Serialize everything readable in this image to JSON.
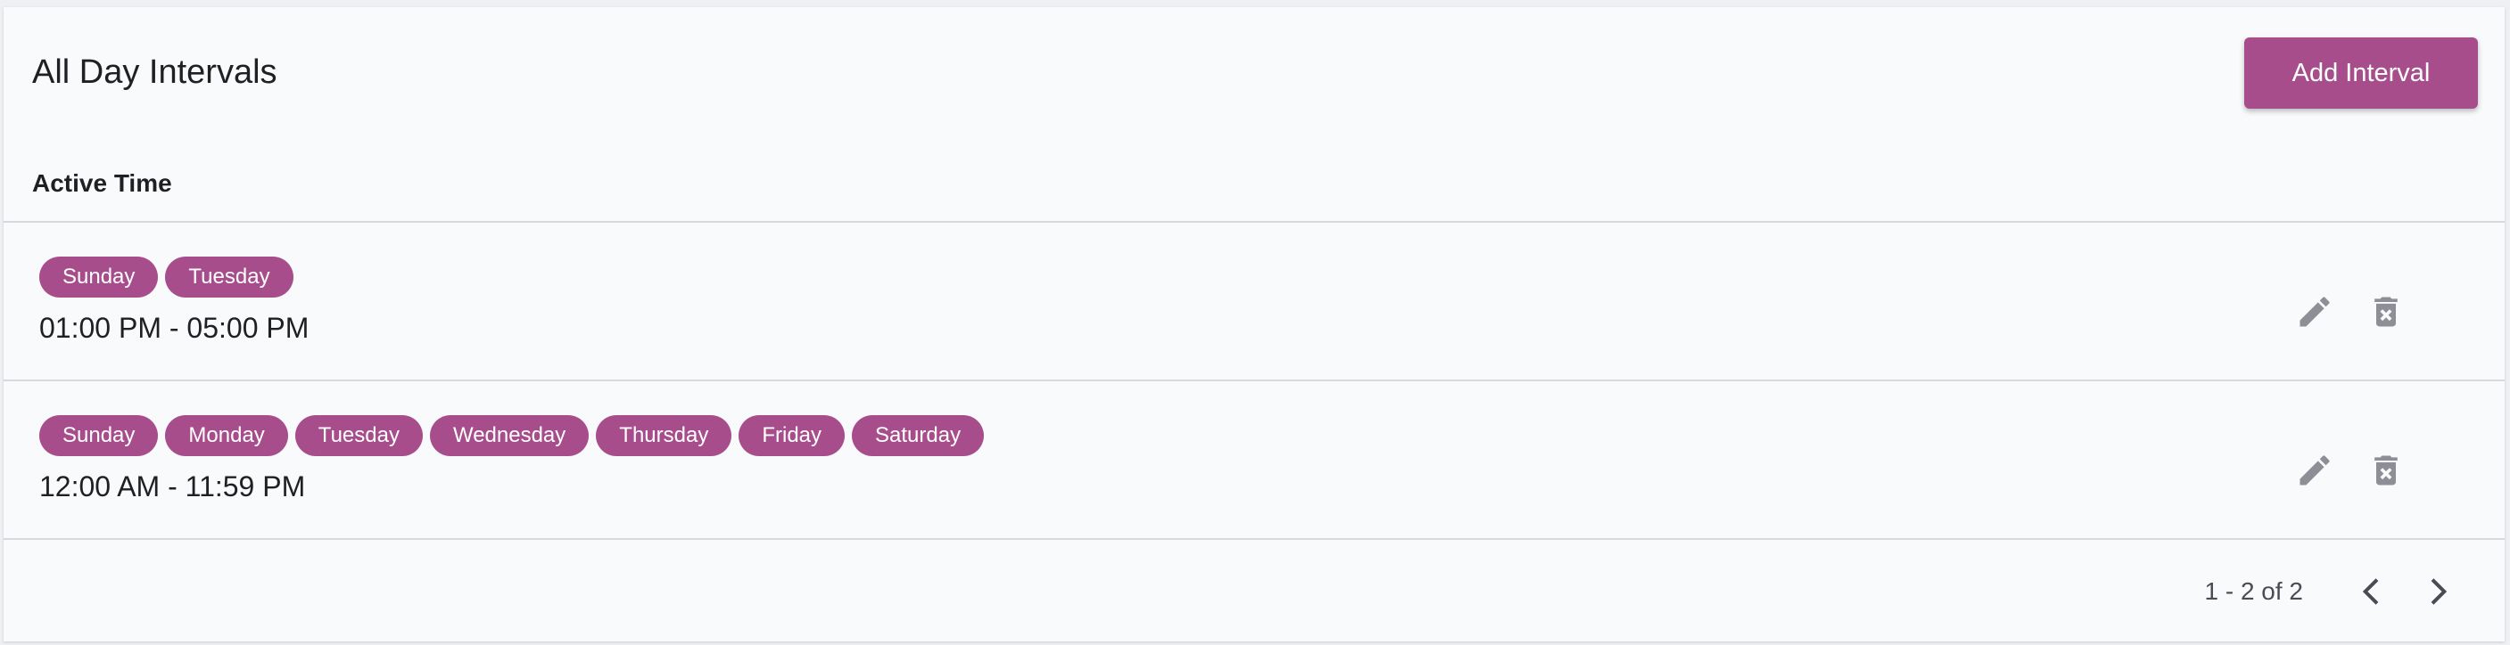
{
  "header": {
    "title": "All Day Intervals",
    "add_label": "Add Interval"
  },
  "table": {
    "column_header": "Active Time",
    "rows": [
      {
        "days": [
          "Sunday",
          "Tuesday"
        ],
        "time": "01:00 PM - 05:00 PM"
      },
      {
        "days": [
          "Sunday",
          "Monday",
          "Tuesday",
          "Wednesday",
          "Thursday",
          "Friday",
          "Saturday"
        ],
        "time": "12:00 AM - 11:59 PM"
      }
    ]
  },
  "pagination": {
    "range": "1 - 2 of 2"
  },
  "icons": {
    "edit": "pencil-icon",
    "delete": "trash-icon",
    "prev": "chevron-left-icon",
    "next": "chevron-right-icon"
  },
  "colors": {
    "accent": "#a74d8c",
    "icon": "#8e8f96",
    "background": "#f9fafc"
  }
}
